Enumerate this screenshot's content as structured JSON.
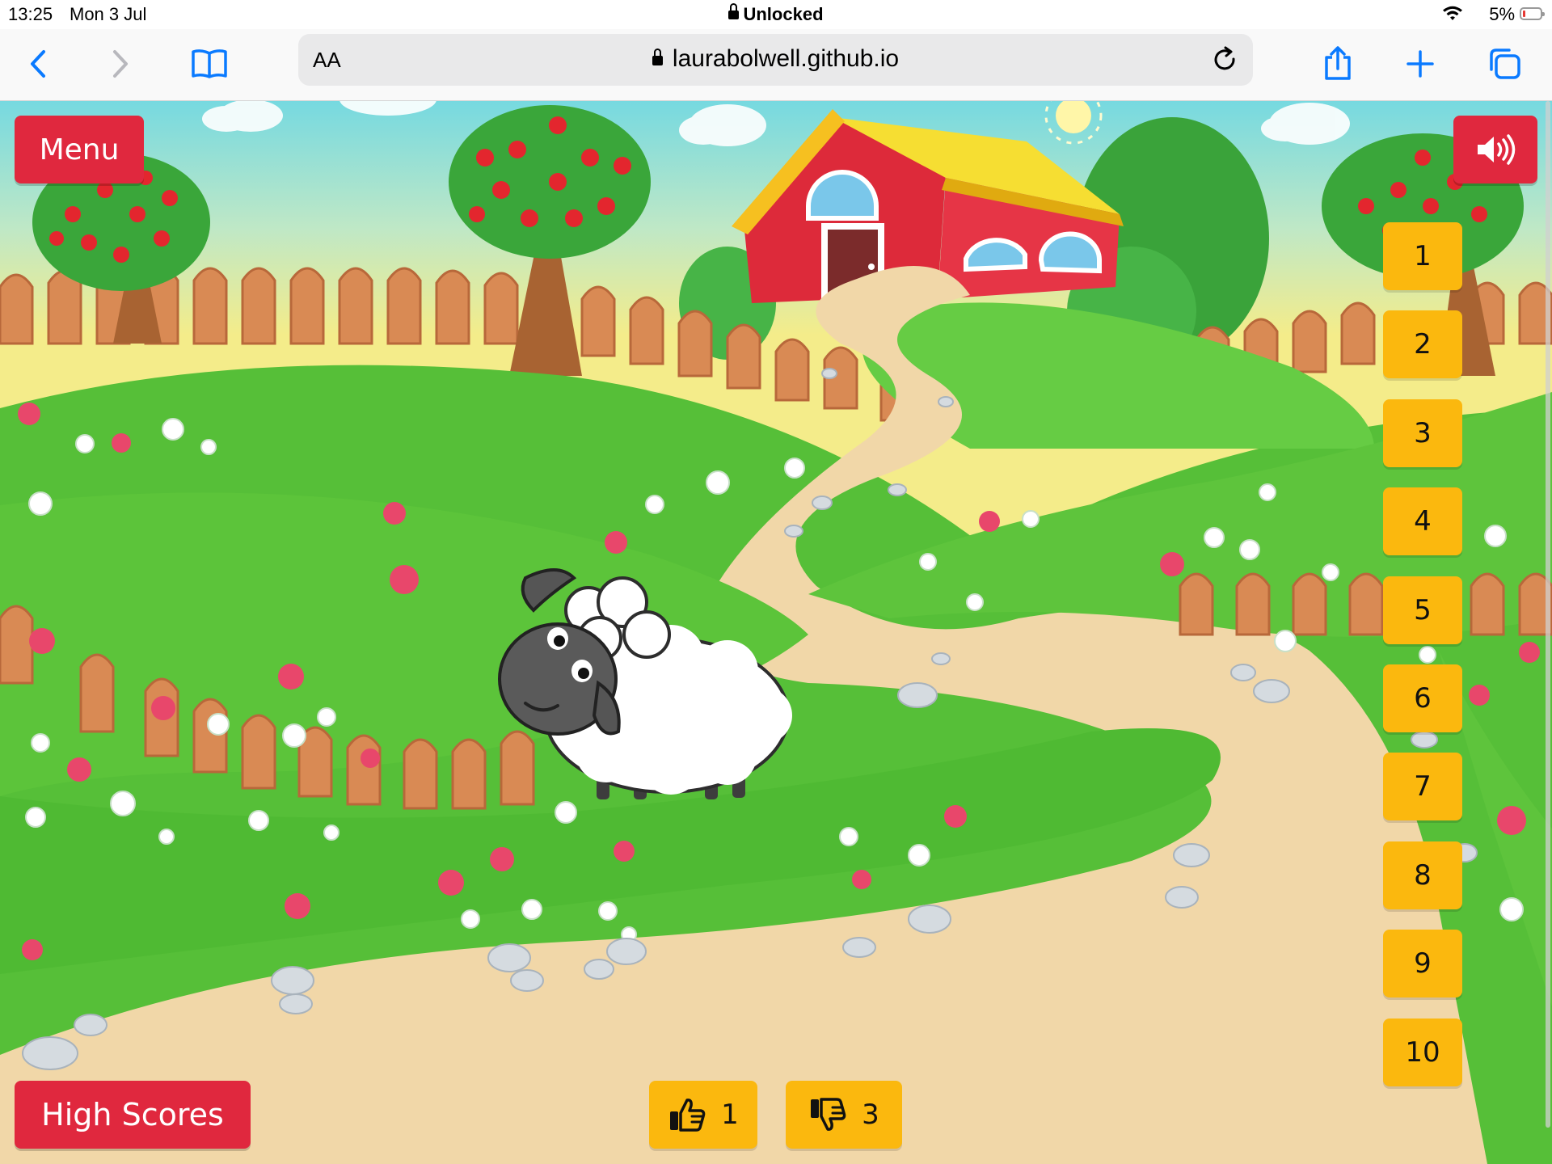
{
  "status_bar": {
    "time": "13:25",
    "date": "Mon 3 Jul",
    "lock_status": "Unlocked",
    "battery": "5%"
  },
  "browser": {
    "text_size_label": "AA",
    "url": "laurabolwell.github.io",
    "icons": [
      "back-icon",
      "forward-icon",
      "bookmarks-icon",
      "reload-icon",
      "share-icon",
      "new-tab-icon",
      "tabs-icon"
    ]
  },
  "game": {
    "menu_label": "Menu",
    "high_scores_label": "High Scores",
    "sound_icon": "speaker-icon",
    "levels": [
      "1",
      "2",
      "3",
      "4",
      "5",
      "6",
      "7",
      "8",
      "9",
      "10"
    ],
    "thumbs_up_count": "1",
    "thumbs_down_count": "3"
  },
  "colors": {
    "red_button": "#e0283e",
    "yellow_button": "#fbb80e",
    "browser_blue": "#0a7aff",
    "grass": "#5cc43a",
    "path": "#f1d7a8"
  }
}
